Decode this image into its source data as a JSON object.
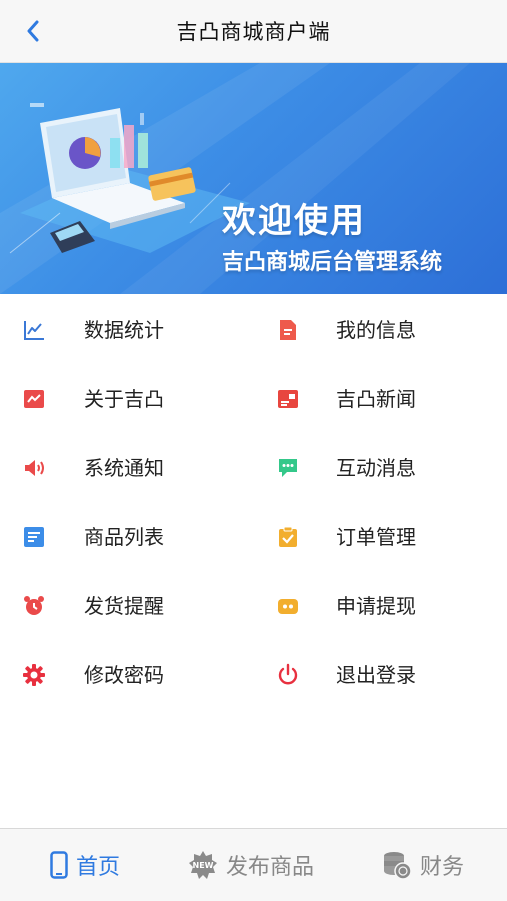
{
  "header": {
    "title": "吉凸商城商户端"
  },
  "banner": {
    "line1": "欢迎使用",
    "line2": "吉凸商城后台管理系统"
  },
  "menu": [
    {
      "label": "数据统计",
      "icon": "line-chart-icon",
      "color": "#3a78d6"
    },
    {
      "label": "我的信息",
      "icon": "document-icon",
      "color": "#ee5a4c"
    },
    {
      "label": "关于吉凸",
      "icon": "trend-icon",
      "color": "#ea4a4a"
    },
    {
      "label": "吉凸新闻",
      "icon": "news-icon",
      "color": "#e8463f"
    },
    {
      "label": "系统通知",
      "icon": "speaker-icon",
      "color": "#ea4a4a"
    },
    {
      "label": "互动消息",
      "icon": "chat-icon",
      "color": "#34c88a"
    },
    {
      "label": "商品列表",
      "icon": "list-icon",
      "color": "#3c8de8"
    },
    {
      "label": "订单管理",
      "icon": "clipboard-check-icon",
      "color": "#f2ae2e"
    },
    {
      "label": "发货提醒",
      "icon": "alarm-clock-icon",
      "color": "#ea4a4a"
    },
    {
      "label": "申请提现",
      "icon": "wallet-icon",
      "color": "#f2ae2e"
    },
    {
      "label": "修改密码",
      "icon": "gear-icon",
      "color": "#e8303f"
    },
    {
      "label": "退出登录",
      "icon": "power-icon",
      "color": "#e8303f"
    }
  ],
  "tabs": [
    {
      "label": "首页",
      "icon": "phone-icon",
      "active": true,
      "color": "#2f7ae0"
    },
    {
      "label": "发布商品",
      "icon": "new-badge-icon",
      "active": false,
      "color": "#888888"
    },
    {
      "label": "财务",
      "icon": "coins-icon",
      "active": false,
      "color": "#888888"
    }
  ]
}
